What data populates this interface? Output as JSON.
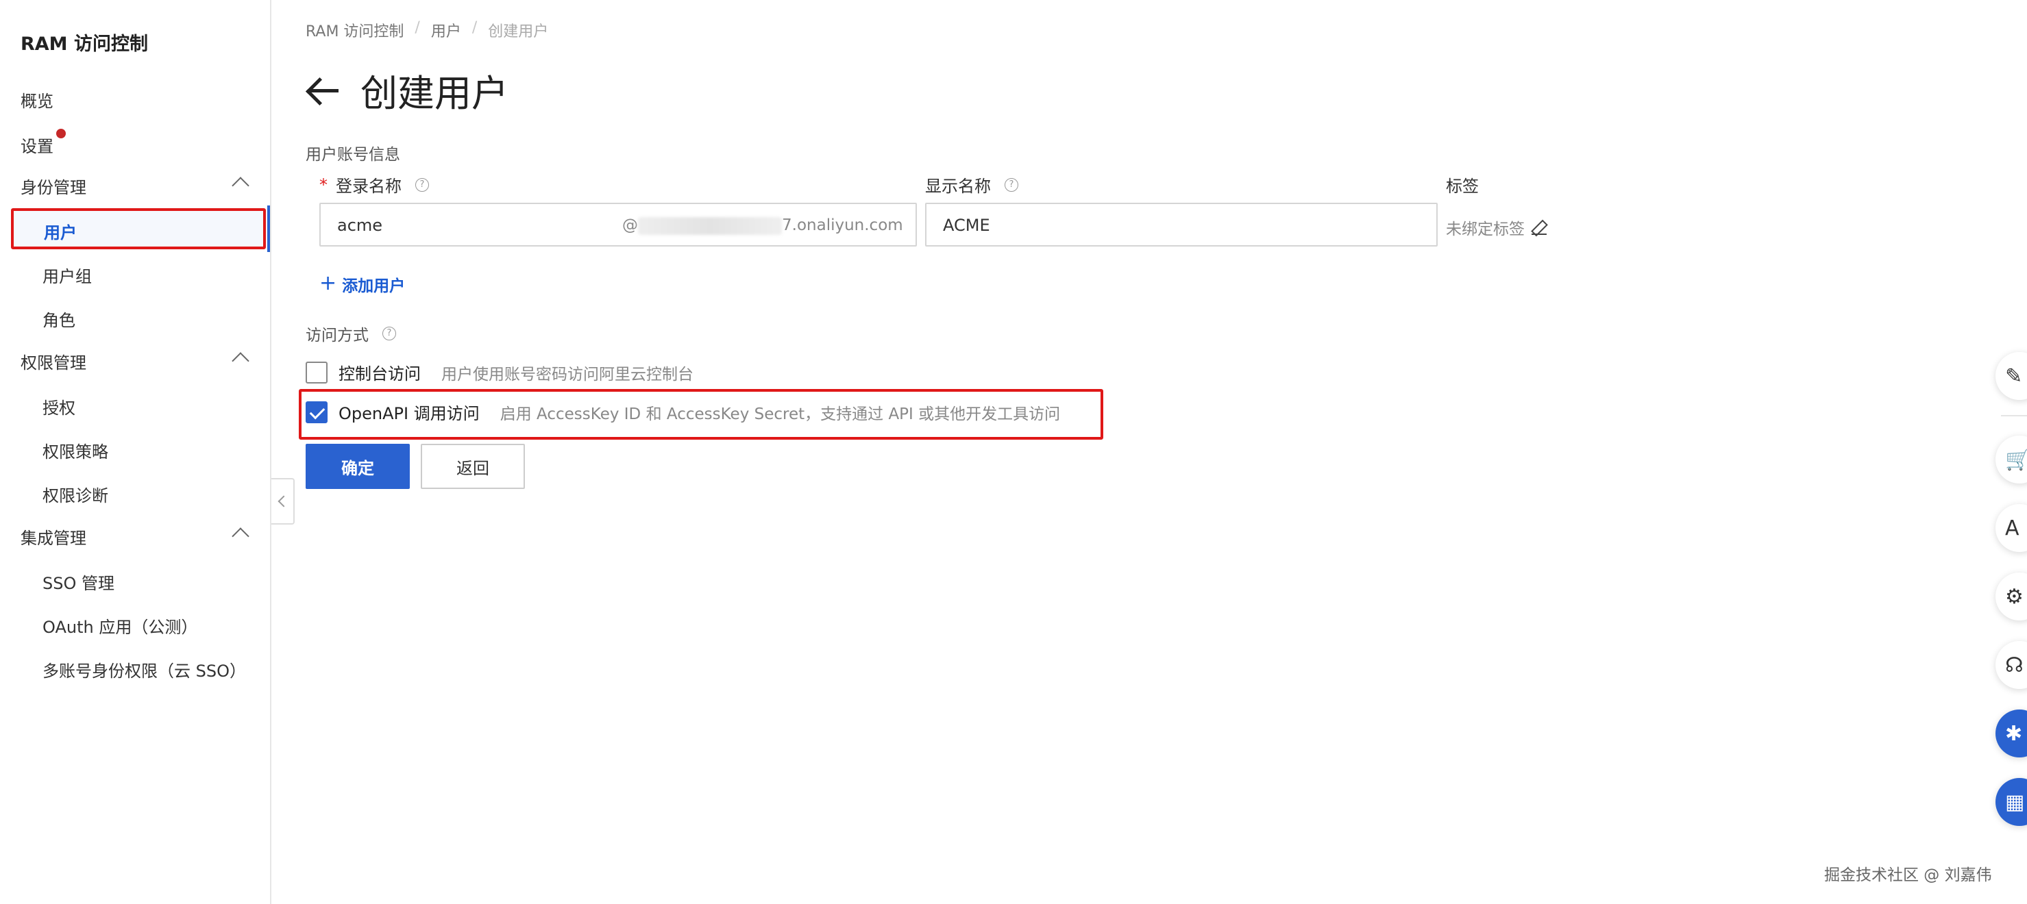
{
  "sidebar": {
    "title": "RAM 访问控制",
    "items": [
      {
        "label": "概览"
      },
      {
        "label": "设置"
      }
    ],
    "groups": {
      "identity": {
        "label": "身份管理",
        "items": [
          "用户",
          "用户组",
          "角色"
        ]
      },
      "permission": {
        "label": "权限管理",
        "items": [
          "授权",
          "权限策略",
          "权限诊断"
        ]
      },
      "integration": {
        "label": "集成管理",
        "items": [
          "SSO 管理",
          "OAuth 应用（公测）",
          "多账号身份权限（云 SSO）"
        ]
      }
    }
  },
  "breadcrumb": [
    "RAM 访问控制",
    "用户",
    "创建用户"
  ],
  "breadcrumb_sep": "/",
  "page": {
    "title": "创建用户"
  },
  "form": {
    "section_title": "用户账号信息",
    "login_name": {
      "label": "登录名称",
      "required_mark": "*",
      "value": "acme",
      "suffix_at": "@",
      "suffix_domain": "7.onaliyun.com"
    },
    "display_name": {
      "label": "显示名称",
      "value": "ACME"
    },
    "tags": {
      "label": "标签",
      "value": "未绑定标签"
    },
    "help_glyph": "?",
    "add_user_label": "添加用户",
    "add_user_plus": "+",
    "access_section": "访问方式",
    "console": {
      "label": "控制台访问",
      "desc": "用户使用账号密码访问阿里云控制台",
      "checked": false
    },
    "openapi": {
      "label": "OpenAPI 调用访问",
      "desc": "启用 AccessKey ID 和 AccessKey Secret，支持通过 API 或其他开发工具访问",
      "checked": true
    },
    "confirm_label": "确定",
    "back_label": "返回"
  },
  "float_toolbar": {
    "icons": [
      "edit-icon",
      "cart-icon",
      "api-icon",
      "settings-icon",
      "headset-icon",
      "assistant-icon",
      "apps-icon"
    ],
    "glyphs": [
      "✎",
      "🛒",
      "A",
      "⚙",
      "☊",
      "✱",
      "▦"
    ]
  },
  "watermark": "掘金技术社区 @ 刘嘉伟",
  "colors": {
    "accent": "#2a62d0",
    "highlight_border": "#e01818",
    "badge": "#c62828"
  }
}
